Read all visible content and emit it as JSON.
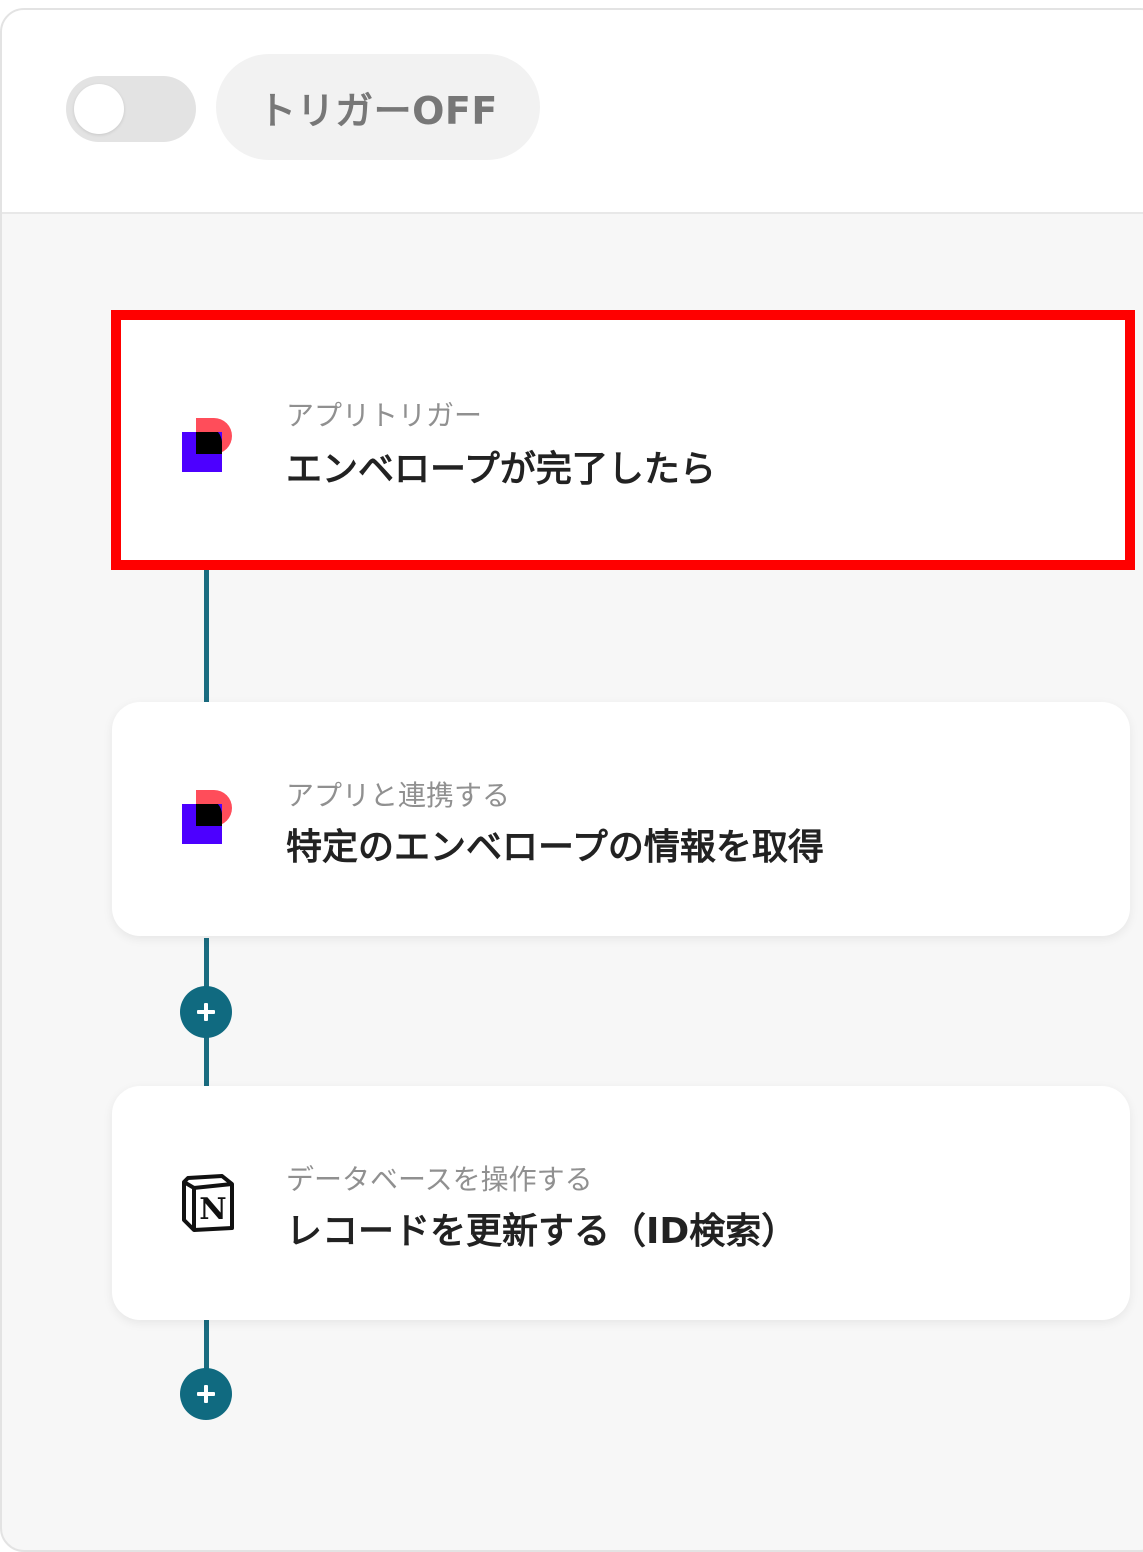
{
  "header": {
    "toggle_state": "off",
    "trigger_label": "トリガーOFF"
  },
  "flow": {
    "steps": [
      {
        "category": "アプリトリガー",
        "title": "エンベロープが完了したら",
        "icon": "docusign-like-app-icon",
        "selected": true
      },
      {
        "category": "アプリと連携する",
        "title": "特定のエンベロープの情報を取得",
        "icon": "docusign-like-app-icon",
        "selected": false
      },
      {
        "category": "データベースを操作する",
        "title": "レコードを更新する（ID検索）",
        "icon": "notion-icon",
        "selected": false
      }
    ],
    "highlight_color": "#ff0000",
    "accent_color": "#106a80"
  }
}
